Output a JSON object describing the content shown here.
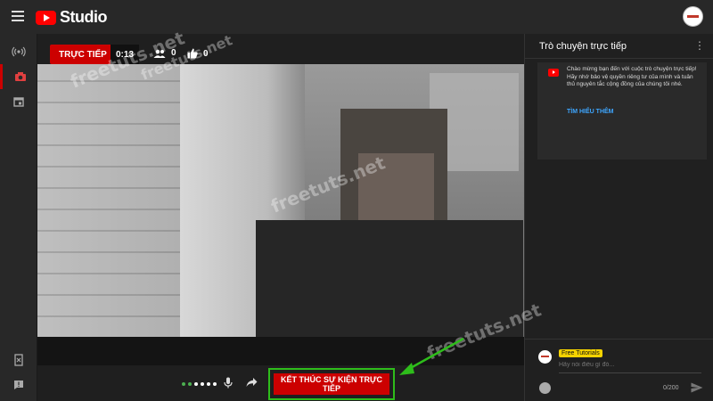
{
  "app": {
    "name": "Studio"
  },
  "stream": {
    "live_label": "TRỰC TIẾP",
    "elapsed": "0:13",
    "viewers": "0",
    "likes": "0",
    "end_button_label": "KẾT THÚC SỰ KIỆN TRỰC TIẾP",
    "health_dots": 6,
    "health_good": 2
  },
  "chat": {
    "title": "Trò chuyện trực tiếp",
    "welcome_text": "Chào mừng bạn đến với cuộc trò chuyện trực tiếp! Hãy nhớ bảo vệ quyền riêng tư của mình và tuân thủ nguyên tắc cộng đồng của chúng tôi nhé.",
    "learn_more": "TÌM HIỂU THÊM",
    "user_name": "Free Tutorials",
    "placeholder": "Hãy nói điều gì đó...",
    "char_count": "0/200"
  },
  "watermarks": [
    "freetuts.net",
    "freetuts.net",
    "freetuts.net",
    "freetuts.net"
  ],
  "colors": {
    "accent": "#cc0000",
    "highlight": "#2ebd1b",
    "link": "#3ea6ff"
  },
  "icons": [
    "menu-icon",
    "youtube-logo-icon",
    "broadcast-icon",
    "camera-icon",
    "calendar-icon",
    "viewers-icon",
    "thumbs-up-icon",
    "mic-icon",
    "share-icon",
    "emoji-icon",
    "send-icon",
    "more-vert-icon"
  ]
}
